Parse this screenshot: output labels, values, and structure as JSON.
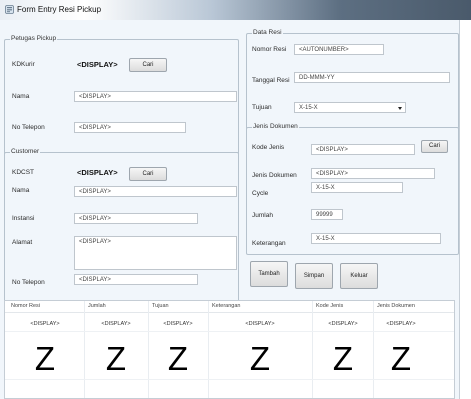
{
  "window": {
    "title": "Form Entry Resi Pickup"
  },
  "petugas_pickup": {
    "legend": "Petugas Pickup",
    "kdkurir_label": "KDKurir",
    "kdkurir_value": "<DISPLAY>",
    "cari_label": "Cari",
    "nama_label": "Nama",
    "nama_value": "<DISPLAY>",
    "telepon_label": "No Telepon",
    "telepon_value": "<DISPLAY>"
  },
  "customer": {
    "legend": "Customer",
    "kdcst_label": "KDCST",
    "kdcst_value": "<DISPLAY>",
    "cari_label": "Cari",
    "nama_label": "Nama",
    "nama_value": "<DISPLAY>",
    "instansi_label": "Instansi",
    "instansi_value": "<DISPLAY>",
    "alamat_label": "Alamat",
    "alamat_value": "<DISPLAY>",
    "telepon_label": "No Telepon",
    "telepon_value": "<DISPLAY>"
  },
  "data_resi": {
    "legend": "Data Resi",
    "nomor_label": "Nomor Resi",
    "nomor_value": "<AUTONUMBER>",
    "tanggal_label": "Tanggal Resi",
    "tanggal_value": "DD-MMM-YY",
    "tujuan_label": "Tujuan",
    "tujuan_value": "X-15-X"
  },
  "jenis_dokumen": {
    "legend": "Jenis Dokumen",
    "kode_label": "Kode Jenis",
    "kode_value": "<DISPLAY>",
    "cari_label": "Cari",
    "jenis_label": "Jenis Dokumen",
    "jenis_value": "<DISPLAY>",
    "cycle_label": "Cycle",
    "cycle_value": "X-15-X",
    "jumlah_label": "Jumlah",
    "jumlah_value": "99999",
    "keterangan_label": "Keterangan",
    "keterangan_value": "X-15-X"
  },
  "actions": {
    "tambah": "Tambah",
    "simpan": "Simpan",
    "keluar": "Keluar"
  },
  "grid": {
    "columns": [
      "Nomor Resi",
      "Jumlah",
      "Tujuan",
      "Keterangan",
      "Kode Jenis",
      "Jenis Dokumen"
    ],
    "row_values": [
      "<DISPLAY>",
      "<DISPLAY>",
      "<DISPLAY>",
      "<DISPLAY>",
      "<DISPLAY>",
      "<DISPLAY>"
    ],
    "big_glyph": "Z"
  },
  "colors": {
    "form_bg": "#f1f6fb",
    "group_border": "#b6c2cd",
    "titlebar_dark": "#4a5a6b"
  }
}
